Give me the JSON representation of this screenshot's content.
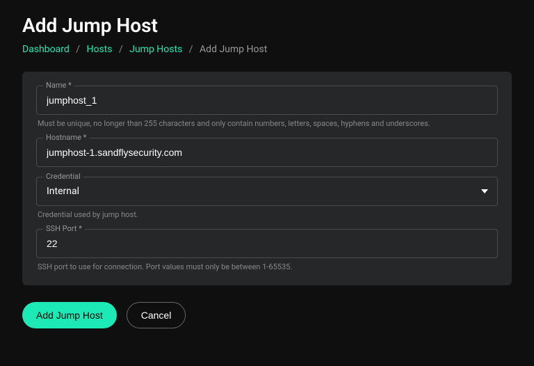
{
  "page": {
    "title": "Add Jump Host"
  },
  "breadcrumb": {
    "items": [
      {
        "label": "Dashboard",
        "link": true
      },
      {
        "label": "Hosts",
        "link": true
      },
      {
        "label": "Jump Hosts",
        "link": true
      },
      {
        "label": "Add Jump Host",
        "link": false
      }
    ],
    "separator": "/"
  },
  "form": {
    "name": {
      "label": "Name *",
      "value": "jumphost_1",
      "help": "Must be unique, no longer than 255 characters and only contain numbers, letters, spaces, hyphens and underscores."
    },
    "hostname": {
      "label": "Hostname *",
      "value": "jumphost-1.sandflysecurity.com"
    },
    "credential": {
      "label": "Credential",
      "value": "Internal",
      "help": "Credential used by jump host."
    },
    "ssh_port": {
      "label": "SSH Port *",
      "value": "22",
      "help": "SSH port to use for connection. Port values must only be between 1-65535."
    }
  },
  "buttons": {
    "submit": "Add Jump Host",
    "cancel": "Cancel"
  }
}
